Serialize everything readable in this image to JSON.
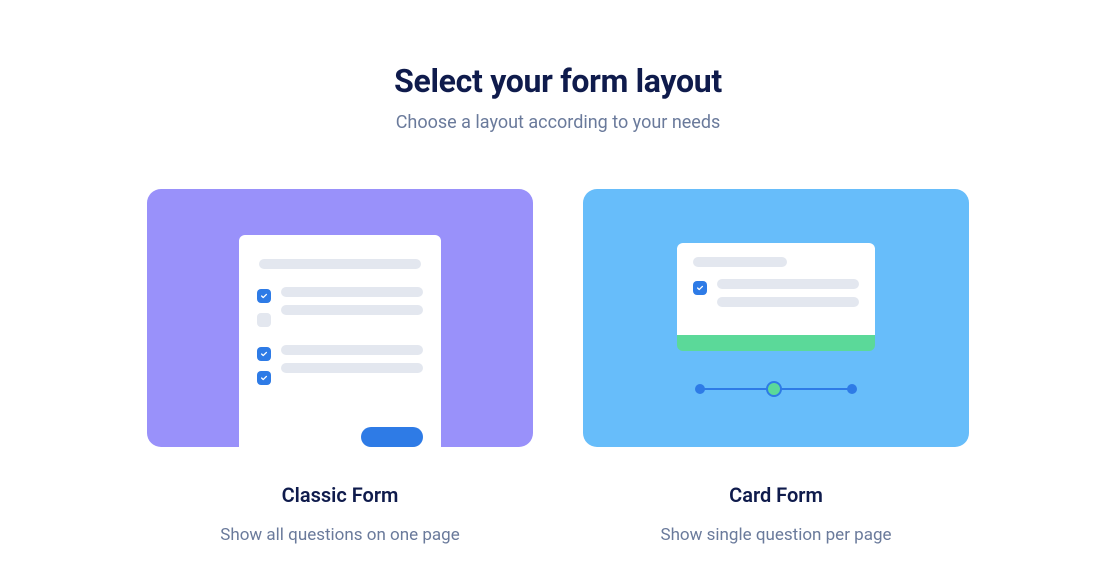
{
  "header": {
    "title": "Select your form layout",
    "subtitle": "Choose a layout according to your needs"
  },
  "options": {
    "classic": {
      "title": "Classic Form",
      "description": "Show all questions on one page"
    },
    "card": {
      "title": "Card Form",
      "description": "Show single question per page"
    }
  }
}
